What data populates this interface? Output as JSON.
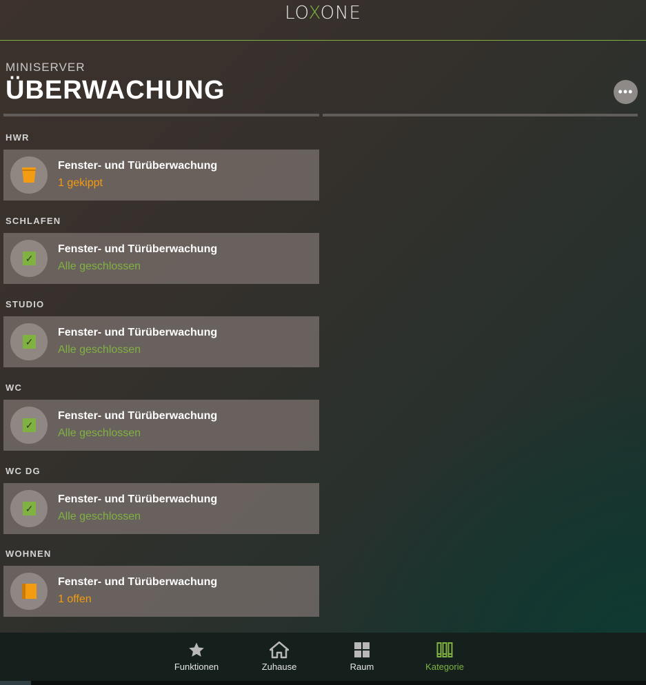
{
  "app": {
    "logo_left": "LO",
    "logo_mid": "X",
    "logo_right": "ONE"
  },
  "header": {
    "subtitle": "MINISERVER",
    "title": "ÜBERWACHUNG",
    "more_label": "•••"
  },
  "rooms": [
    {
      "label": "HWR",
      "card_name": "Fenster- und Türüberwachung",
      "status": "1 gekippt",
      "status_color": "#f39c12",
      "icon": "window-tilted-icon"
    },
    {
      "label": "SCHLAFEN",
      "card_name": "Fenster- und Türüberwachung",
      "status": "Alle geschlossen",
      "status_color": "#7fb241",
      "icon": "window-closed-check-icon"
    },
    {
      "label": "STUDIO",
      "card_name": "Fenster- und Türüberwachung",
      "status": "Alle geschlossen",
      "status_color": "#7fb241",
      "icon": "window-closed-check-icon"
    },
    {
      "label": "WC",
      "card_name": "Fenster- und Türüberwachung",
      "status": "Alle geschlossen",
      "status_color": "#7fb241",
      "icon": "window-closed-check-icon"
    },
    {
      "label": "WC DG",
      "card_name": "Fenster- und Türüberwachung",
      "status": "Alle geschlossen",
      "status_color": "#7fb241",
      "icon": "window-closed-check-icon"
    },
    {
      "label": "WOHNEN",
      "card_name": "Fenster- und Türüberwachung",
      "status": "1 offen",
      "status_color": "#f39c12",
      "icon": "window-open-icon"
    }
  ],
  "nav": [
    {
      "label": "Funktionen",
      "icon": "star-icon",
      "active": false
    },
    {
      "label": "Zuhause",
      "icon": "home-icon",
      "active": false
    },
    {
      "label": "Raum",
      "icon": "grid-icon",
      "active": false
    },
    {
      "label": "Kategorie",
      "icon": "category-icon",
      "active": true
    }
  ],
  "colors": {
    "accent": "#7fb241",
    "warning": "#f39c12"
  }
}
